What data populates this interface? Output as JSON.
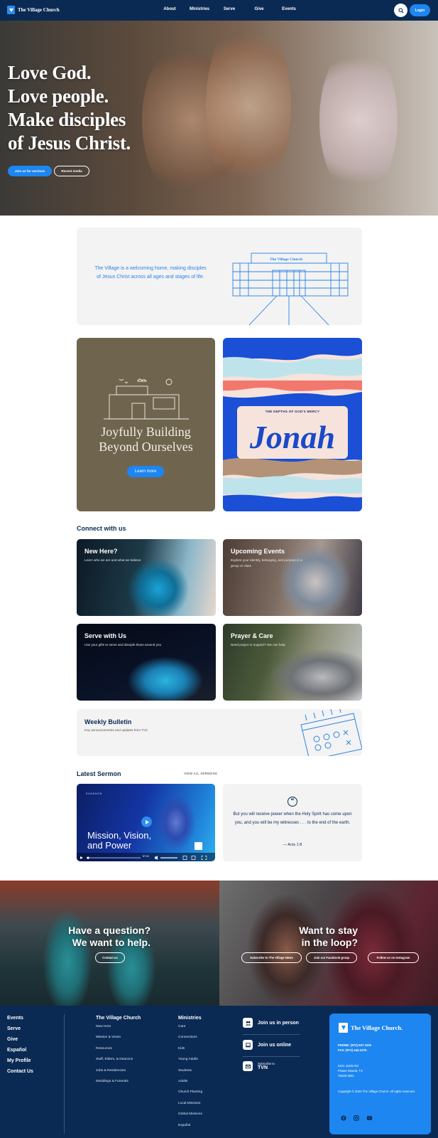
{
  "nav": {
    "brand": "The Village Church",
    "links": [
      "About",
      "Ministries",
      "Serve",
      "Give",
      "Events"
    ],
    "login": "Login"
  },
  "hero": {
    "title_lines": [
      "Love God.",
      "Love people.",
      "Make disciples",
      "of Jesus Christ."
    ],
    "primary_button": "Join us for services",
    "secondary_button": "Recent media"
  },
  "welcome": {
    "text": "The Village is a welcoming home, making disciples of Jesus Christ across all ages and stages of life.",
    "sign_text": "The Village Church"
  },
  "feature_building": {
    "title_line1": "Joyfully Building",
    "title_line2": "Beyond Ourselves",
    "button": "Learn more"
  },
  "feature_jonah": {
    "subtitle": "THE DEPTHS OF GOD'S MERCY",
    "title": "Jonah"
  },
  "connect": {
    "heading": "Connect with us",
    "tiles": [
      {
        "title": "New Here?",
        "subtitle": "Learn who we are and what we believe"
      },
      {
        "title": "Upcoming Events",
        "subtitle": "Explore your identity, belonging, and purpose in a group or class"
      },
      {
        "title": "Serve with Us",
        "subtitle": "Use your gifts to serve and disciple those around you"
      },
      {
        "title": "Prayer & Care",
        "subtitle": "Need prayer or support? We can help."
      }
    ],
    "bulletin": {
      "title": "Weekly Bulletin",
      "subtitle": "Key announcements and updates from TVC"
    }
  },
  "sermon": {
    "heading": "Latest Sermon",
    "view_all": "VIEW ALL SERMONS",
    "video": {
      "brand": "SHANNON",
      "title_lines": [
        "Mission, Vision,",
        "and Power"
      ],
      "time": "57:03"
    },
    "quote": {
      "text": "But you will receive power when the Holy Spirit has come upon you, and you will be my witnesses . . . to the end of the earth.",
      "reference": "— Acts 1:8"
    }
  },
  "cta": {
    "left": {
      "title_lines": [
        "Have a question?",
        "We want to help."
      ],
      "button": "Contact us"
    },
    "right": {
      "title_lines": [
        "Want to stay",
        "in the loop?"
      ],
      "buttons": [
        "Subscribe to The Village News",
        "Join our Facebook group",
        "Follow us on Instagram"
      ]
    }
  },
  "footer": {
    "main_links": [
      "Events",
      "Serve",
      "Give",
      "Español",
      "My Profile",
      "Contact Us"
    ],
    "church_col": {
      "heading": "The Village Church",
      "items": [
        "New Here",
        "Mission & Vision",
        "Resources",
        "Staff, Elders, & Deacons",
        "Jobs & Residencies",
        "Weddings & Funerals"
      ]
    },
    "ministries_col": {
      "heading": "Ministries",
      "items": [
        "Care",
        "Connections",
        "Kids",
        "Young Adults",
        "Students",
        "Adults",
        "Church Planting",
        "Local Missions",
        "Global Missions",
        "Español"
      ]
    },
    "join": {
      "in_person": "Join us in person",
      "online": "Join us online",
      "subscribe_label": "Subscribe to",
      "subscribe_name": "TVN"
    },
    "card": {
      "brand": "The Village Church.",
      "phone": "PHONE: (972) 537-1100",
      "fax": "FAX: (972) 444-2275",
      "address_lines": [
        "2101 Justin Rd",
        "Flower Mound, TX",
        "75028-3691"
      ],
      "copyright": "Copyright © 2022 The Village Church. All rights reserved."
    }
  },
  "colors": {
    "navy": "#0a2a54",
    "accent_blue": "#1d86f0",
    "light_panel": "#f3f3f3",
    "olive_card": "#6f654f"
  }
}
